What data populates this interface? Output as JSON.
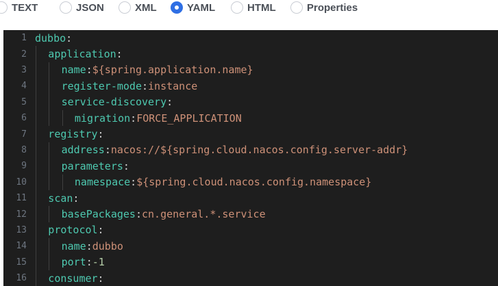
{
  "format_bar": {
    "options": [
      {
        "label": "TEXT",
        "checked": false
      },
      {
        "label": "JSON",
        "checked": false
      },
      {
        "label": "XML",
        "checked": false
      },
      {
        "label": "YAML",
        "checked": true
      },
      {
        "label": "HTML",
        "checked": false
      },
      {
        "label": "Properties",
        "checked": false
      }
    ],
    "accent_color": "#2f6fe4"
  },
  "editor": {
    "theme_background": "#1e1e1e",
    "key_color": "#4ec9b0",
    "value_color": "#ce9178",
    "number_color": "#b5cea8",
    "lines": [
      {
        "number": "1",
        "depth": 0,
        "key": "dubbo",
        "value": "",
        "value_type": "none"
      },
      {
        "number": "2",
        "depth": 1,
        "key": "application",
        "value": "",
        "value_type": "none"
      },
      {
        "number": "3",
        "depth": 2,
        "key": "name",
        "value": "${spring.application.name}",
        "value_type": "string"
      },
      {
        "number": "4",
        "depth": 2,
        "key": "register-mode",
        "value": "instance",
        "value_type": "string"
      },
      {
        "number": "5",
        "depth": 2,
        "key": "service-discovery",
        "value": "",
        "value_type": "none"
      },
      {
        "number": "6",
        "depth": 3,
        "key": "migration",
        "value": "FORCE_APPLICATION",
        "value_type": "string"
      },
      {
        "number": "7",
        "depth": 1,
        "key": "registry",
        "value": "",
        "value_type": "none"
      },
      {
        "number": "8",
        "depth": 2,
        "key": "address",
        "value": "nacos://${spring.cloud.nacos.config.server-addr}",
        "value_type": "string"
      },
      {
        "number": "9",
        "depth": 2,
        "key": "parameters",
        "value": "",
        "value_type": "none"
      },
      {
        "number": "10",
        "depth": 3,
        "key": "namespace",
        "value": "${spring.cloud.nacos.config.namespace}",
        "value_type": "string"
      },
      {
        "number": "11",
        "depth": 1,
        "key": "scan",
        "value": "",
        "value_type": "none"
      },
      {
        "number": "12",
        "depth": 2,
        "key": "basePackages",
        "value": "cn.general.*.service",
        "value_type": "string"
      },
      {
        "number": "13",
        "depth": 1,
        "key": "protocol",
        "value": "",
        "value_type": "none"
      },
      {
        "number": "14",
        "depth": 2,
        "key": "name",
        "value": "dubbo",
        "value_type": "string"
      },
      {
        "number": "15",
        "depth": 2,
        "key": "port",
        "value": "-1",
        "value_type": "number"
      },
      {
        "number": "16",
        "depth": 1,
        "key": "consumer",
        "value": "",
        "value_type": "none"
      }
    ]
  }
}
